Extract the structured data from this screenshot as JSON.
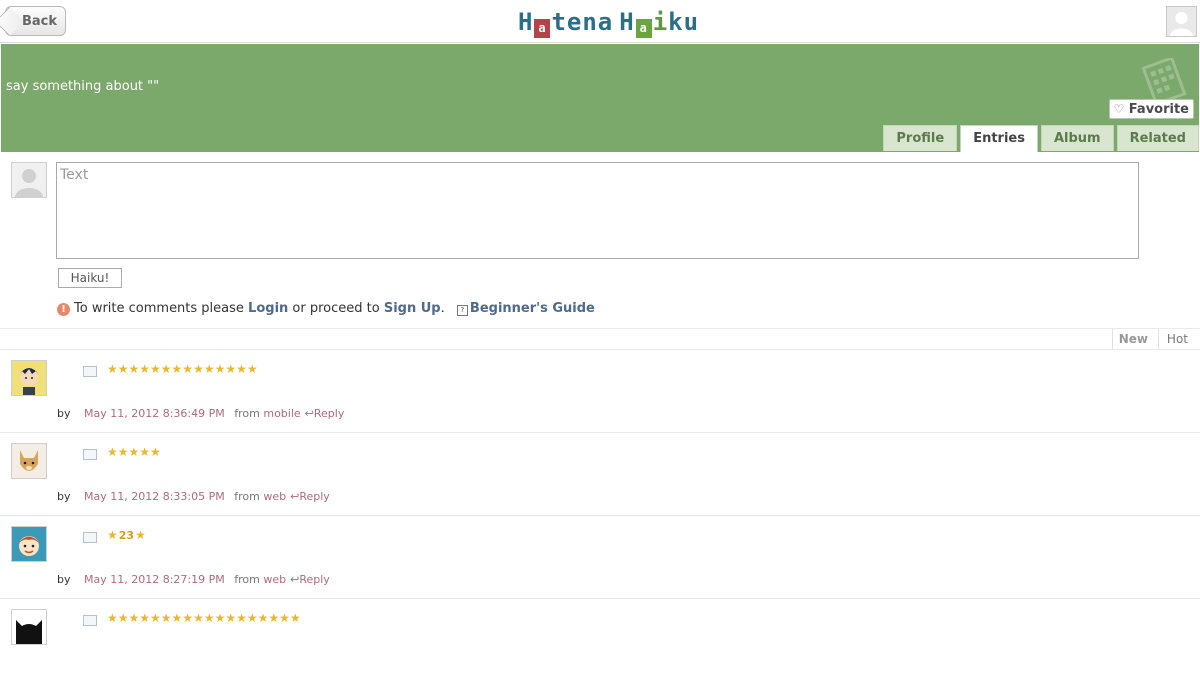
{
  "topbar": {
    "back_label": "Back",
    "logo_text": "Hatena Haiku"
  },
  "hero": {
    "title": "say something about \"\"",
    "favorite_label": "Favorite",
    "tabs": [
      {
        "label": "Profile",
        "active": false
      },
      {
        "label": "Entries",
        "active": true
      },
      {
        "label": "Album",
        "active": false
      },
      {
        "label": "Related",
        "active": false
      }
    ]
  },
  "composer": {
    "placeholder": "Text",
    "submit_label": "Haiku!",
    "notice_prefix": "To write comments please",
    "login_label": "Login",
    "notice_middle": "or proceed to",
    "signup_label": "Sign Up",
    "notice_suffix": ".",
    "guide_label": "Beginner's Guide"
  },
  "sort": {
    "new_label": "New",
    "hot_label": "Hot"
  },
  "entries": [
    {
      "stars": "★★★★★★★★★★★★★★",
      "by_label": "by",
      "time": "May 11, 2012 8:36:49 PM",
      "from_label": "from",
      "source": "mobile",
      "reply_label": "Reply"
    },
    {
      "stars": "★★★★★",
      "by_label": "by",
      "time": "May 11, 2012 8:33:05 PM",
      "from_label": "from",
      "source": "web",
      "reply_label": "Reply"
    },
    {
      "star_left": "★",
      "star_count": "23",
      "star_right": "★",
      "by_label": "by",
      "time": "May 11, 2012 8:27:19 PM",
      "from_label": "from",
      "source": "web",
      "reply_label": "Reply"
    },
    {
      "stars": "★★★★★★★★★★★★★★★★★★"
    }
  ],
  "colors": {
    "hero_bg": "#7ba86b",
    "link": "#4e6a8d",
    "meta_accent": "#b06a7a",
    "star": "#e8b830"
  }
}
